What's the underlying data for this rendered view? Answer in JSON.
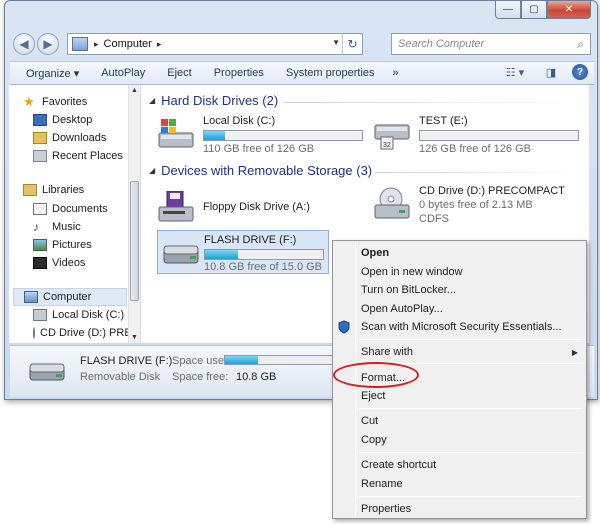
{
  "window": {
    "caption_buttons": {
      "minimize": "—",
      "maximize": "▢",
      "close": "✕"
    }
  },
  "address": {
    "root_glyph": "▸",
    "path_item": "Computer",
    "path_arrow": "▸",
    "dropdown_glyph": "▼",
    "refresh_glyph": "↻",
    "search_placeholder": "Search Computer",
    "back_glyph": "◀",
    "forward_glyph": "▶"
  },
  "toolbar": {
    "organize": "Organize ▾",
    "autoplay": "AutoPlay",
    "eject": "Eject",
    "properties": "Properties",
    "system_properties": "System properties",
    "overflow": "»",
    "view_glyph": "☷ ▾",
    "preview_glyph": "◨",
    "help_glyph": "?"
  },
  "nav": {
    "favorites": "Favorites",
    "desktop": "Desktop",
    "downloads": "Downloads",
    "recent_places": "Recent Places",
    "libraries": "Libraries",
    "documents": "Documents",
    "music": "Music",
    "pictures": "Pictures",
    "videos": "Videos",
    "computer": "Computer",
    "local_disk": "Local Disk (C:)",
    "cd_drive": "CD Drive (D:) PRE"
  },
  "groups": {
    "hard_disk": "Hard Disk Drives (2)",
    "removable": "Devices with Removable Storage (3)"
  },
  "drives": {
    "c": {
      "name": "Local Disk (C:)",
      "free": "110 GB free of 126 GB",
      "used_fraction": 0.13
    },
    "e": {
      "name": "TEST (E:)",
      "free": "126 GB free of 126 GB",
      "used_fraction": 0.0
    },
    "a": {
      "name": "Floppy Disk Drive (A:)"
    },
    "d": {
      "name": "CD Drive (D:) PRECOMPACT",
      "free": "0 bytes free of 2.13 MB",
      "fs": "CDFS"
    },
    "f": {
      "name": "FLASH DRIVE (F:)",
      "free": "10.8 GB free of 15.0 GB",
      "used_fraction": 0.28
    }
  },
  "details": {
    "name": "FLASH DRIVE (F:)",
    "type": "Removable Disk",
    "space_used_label": "Space used:",
    "space_free_label": "Space free:",
    "space_free_value": "10.8 GB",
    "used_fraction": 0.28
  },
  "context_menu": {
    "open": "Open",
    "open_new_window": "Open in new window",
    "bitlocker": "Turn on BitLocker...",
    "open_autoplay": "Open AutoPlay...",
    "scan": "Scan with Microsoft Security Essentials...",
    "share_with": "Share with",
    "format": "Format...",
    "eject": "Eject",
    "cut": "Cut",
    "copy": "Copy",
    "create_shortcut": "Create shortcut",
    "rename": "Rename",
    "properties": "Properties",
    "submenu_arrow": "▶"
  },
  "colors": {
    "accent": "#1aa1d8",
    "highlight_circle": "#d21f1f",
    "group_header": "#1e3287"
  }
}
